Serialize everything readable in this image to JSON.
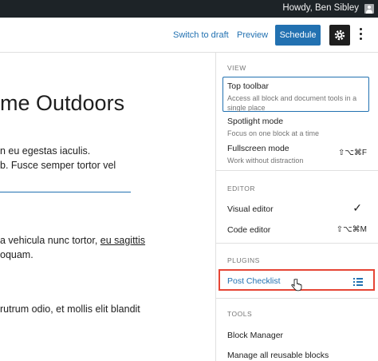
{
  "admin_bar": {
    "greeting": "Howdy, Ben Sibley"
  },
  "header": {
    "switch_to_draft": "Switch to draft",
    "preview": "Preview",
    "schedule": "Schedule"
  },
  "content": {
    "title": "me Outdoors",
    "paragraph1": [
      "n eu egestas iaculis.",
      "b. Fusce semper tortor vel"
    ],
    "paragraph2": [
      "a vehicula nunc tortor, ",
      "eu sagittis",
      "oquam."
    ],
    "paragraph3": "rutrum odio, et mollis elit blandit"
  },
  "menu": {
    "view": {
      "label": "VIEW",
      "items": [
        {
          "label": "Top toolbar",
          "desc": "Access all block and document tools in a single place"
        },
        {
          "label": "Spotlight mode",
          "desc": "Focus on one block at a time"
        },
        {
          "label": "Fullscreen mode",
          "desc": "Work without distraction",
          "shortcut": "⇧⌥⌘F"
        }
      ]
    },
    "editor": {
      "label": "EDITOR",
      "items": [
        {
          "label": "Visual editor",
          "check": "✓"
        },
        {
          "label": "Code editor",
          "shortcut": "⇧⌥⌘M"
        }
      ]
    },
    "plugins": {
      "label": "PLUGINS",
      "items": [
        {
          "label": "Post Checklist",
          "icon": "list-icon"
        }
      ]
    },
    "tools": {
      "label": "TOOLS",
      "items": [
        {
          "label": "Block Manager"
        },
        {
          "label": "Manage all reusable blocks"
        }
      ]
    }
  },
  "colors": {
    "accent": "#2271b1",
    "highlight": "#e64535",
    "admin_bar": "#1d2327"
  }
}
